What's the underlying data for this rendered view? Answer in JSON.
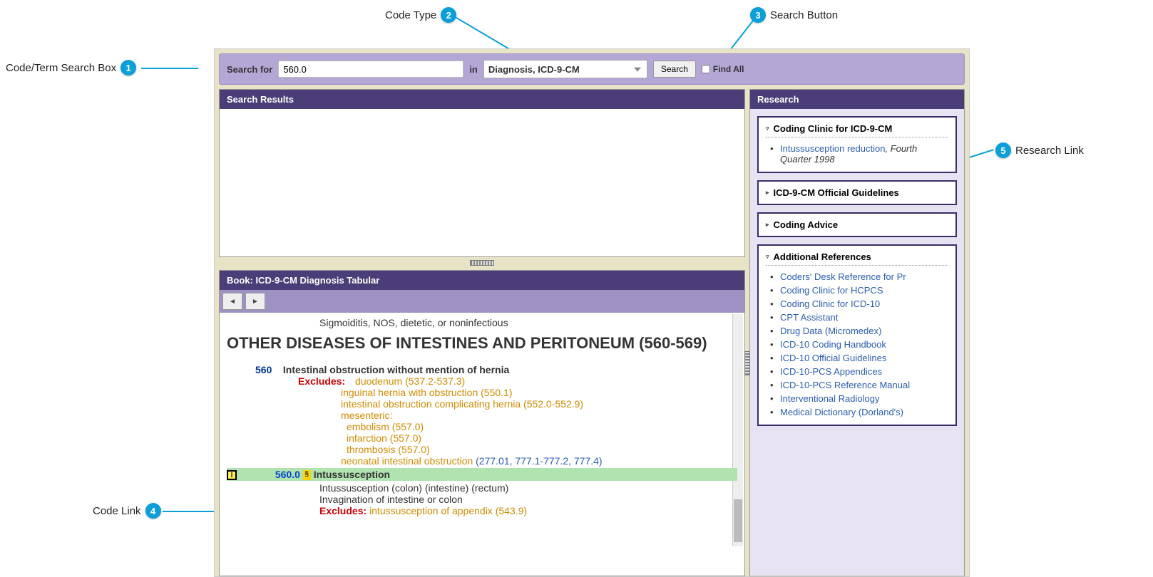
{
  "callouts": {
    "c1": "Code/Term Search Box",
    "c2": "Code Type",
    "c3": "Search Button",
    "c4": "Code Link",
    "c5": "Research Link"
  },
  "search": {
    "label": "Search for",
    "value": "560.0",
    "in_label": "in",
    "select_value": "Diagnosis, ICD-9-CM",
    "button": "Search",
    "findall": "Find All"
  },
  "panels": {
    "results": "Search Results",
    "book": "Book: ICD-9-CM Diagnosis Tabular",
    "research": "Research"
  },
  "book": {
    "frag_top": "Sigmoiditis, NOS, dietetic, or noninfectious",
    "heading": "OTHER DISEASES OF INTESTINES AND PERITONEUM (560-569)",
    "code560": "560",
    "code560_title": "Intestinal obstruction without mention of hernia",
    "excludes_label": "Excludes:",
    "exc1": "duodenum (537.2-537.3)",
    "exc2": "inguinal hernia with obstruction (550.1)",
    "exc3": "intestinal obstruction complicating hernia (552.0-552.9)",
    "exc4": "mesenteric:",
    "exc4a": "embolism (557.0)",
    "exc4b": "infarction (557.0)",
    "exc4c": "thrombosis (557.0)",
    "exc5_pre": "neonatal intestinal obstruction ",
    "exc5_codes": "(277.01, 777.1-777.2, 777.4)",
    "hlcode": "560.0",
    "hltitle": "Intussusception",
    "sub1": "Intussusception (colon) (intestine) (rectum)",
    "sub2": "Invagination of intestine or colon",
    "excl2": "Excludes:",
    "excl2_text": "intussusception of appendix (543.9)"
  },
  "research": {
    "coding_clinic_title": "Coding Clinic for ICD-9-CM",
    "item1_link": "Intussusception reduction",
    "item1_suffix": ", Fourth Quarter 1998",
    "guidelines": "ICD-9-CM Official Guidelines",
    "advice": "Coding Advice",
    "addl_title": "Additional References",
    "refs": [
      "Coders' Desk Reference for Pr",
      "Coding Clinic for HCPCS",
      "Coding Clinic for ICD-10",
      "CPT Assistant",
      "Drug Data (Micromedex)",
      "ICD-10 Coding Handbook",
      "ICD-10 Official Guidelines",
      "ICD-10-PCS Appendices",
      "ICD-10-PCS Reference Manual",
      "Interventional Radiology",
      "Medical Dictionary (Dorland's)"
    ]
  }
}
